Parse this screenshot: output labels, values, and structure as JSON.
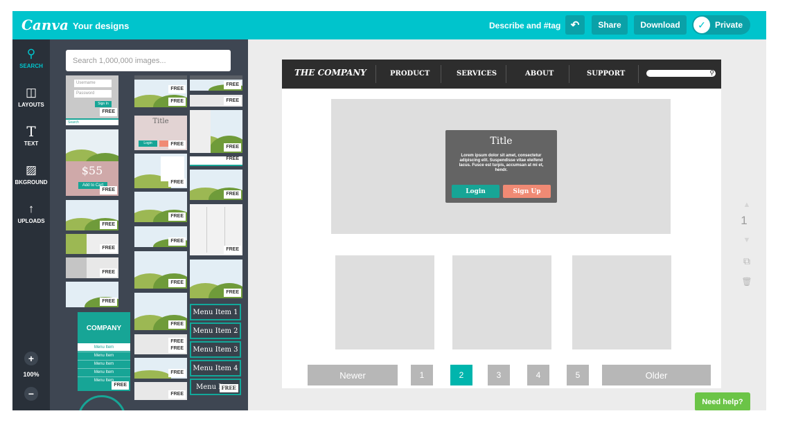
{
  "topbar": {
    "logo": "Canva",
    "your_designs": "Your designs",
    "describe": "Describe and #tag",
    "undo_icon": "↶",
    "share": "Share",
    "download": "Download",
    "privacy": "Private",
    "check_icon": "✓"
  },
  "rail": {
    "items": [
      {
        "label": "SEARCH",
        "icon": "⚲"
      },
      {
        "label": "LAYOUTS",
        "icon": "◫"
      },
      {
        "label": "TEXT",
        "icon": "T"
      },
      {
        "label": "BKGROUND",
        "icon": "▨"
      },
      {
        "label": "UPLOADS",
        "icon": "↑"
      }
    ],
    "zoom_in": "+",
    "zoom_level": "100%",
    "zoom_out": "−"
  },
  "panel": {
    "search_placeholder": "Search 1,000,000 images...",
    "free_badge": "FREE",
    "menu_items": [
      "Menu Item 1",
      "Menu Item 2",
      "Menu Item 3",
      "Menu Item 4",
      "Menu It"
    ],
    "thumb_texts": {
      "username": "Username",
      "password": "Password",
      "signin": "Sign In",
      "search": "Search",
      "title": "Title",
      "login": "Login",
      "price": "$55",
      "add_to_cart": "Add to Cart",
      "company": "COMPANY",
      "menu_item": "Menu Item"
    }
  },
  "design": {
    "brand": "THE COMPANY",
    "nav_links": [
      "PRODUCT",
      "SERVICES",
      "ABOUT",
      "SUPPORT"
    ],
    "modal": {
      "title": "Title",
      "body": "Lorem ipsum dolor sit amet, consectetur adipiscing elit. Suspendisse vitae eleifend lacus. Fusce est turpis, accumsan at mi et, hendr.",
      "login": "Login",
      "signup": "Sign Up"
    },
    "pagination": {
      "newer": "Newer",
      "pages": [
        "1",
        "2",
        "3",
        "4",
        "5"
      ],
      "current": "2",
      "older": "Older"
    }
  },
  "right_tools": {
    "page_number": "1",
    "up_icon": "▲",
    "down_icon": "▼",
    "copy_icon": "⧉",
    "trash_icon": "🗑"
  },
  "help": "Need help?",
  "colors": {
    "brand": "#00c4cc",
    "rail": "#293039",
    "panel": "#3e4652",
    "accent_teal": "#17a596",
    "accent_salmon": "#f08a74",
    "help_green": "#6bc447"
  }
}
